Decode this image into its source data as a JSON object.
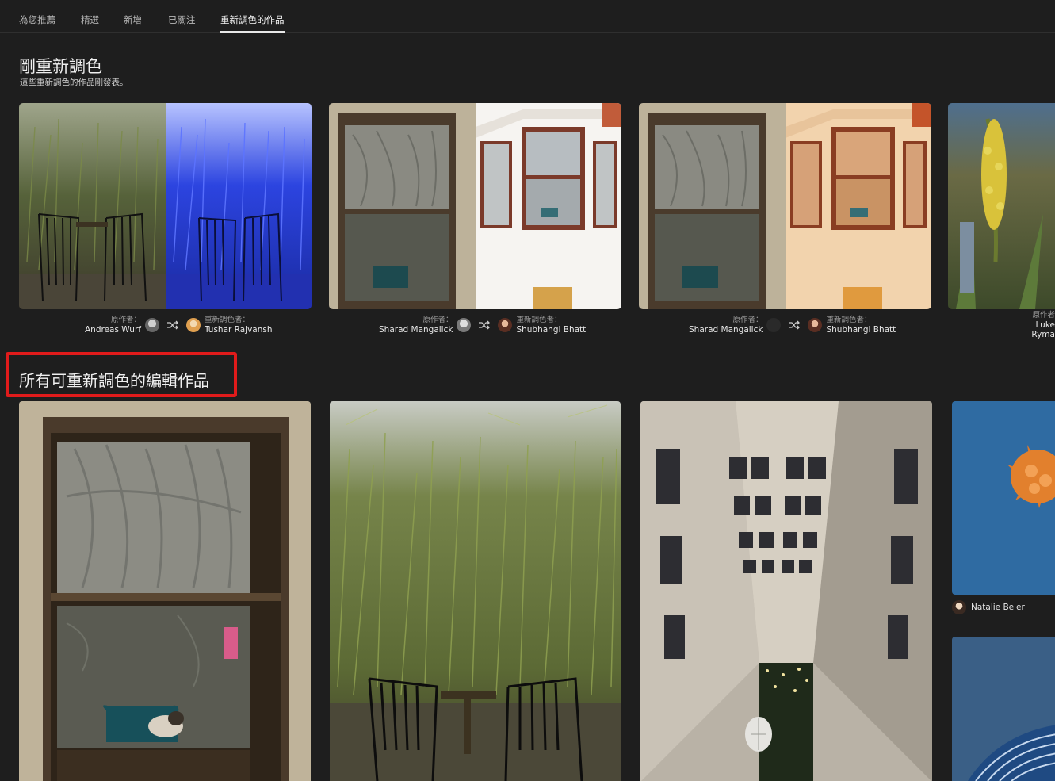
{
  "tabs": [
    {
      "label": "為您推薦",
      "active": false
    },
    {
      "label": "精選",
      "active": false
    },
    {
      "label": "新增",
      "active": false
    },
    {
      "label": "已關注",
      "active": false
    },
    {
      "label": "重新調色的作品",
      "active": true
    }
  ],
  "section1": {
    "title": "剛重新調色",
    "subtitle": "這些重新調色的作品剛發表。",
    "cards": [
      {
        "original_label": "原作者：",
        "original_name": "Andreas Wurf",
        "remix_label": "重新調色者：",
        "remix_name": "Tushar Rajvansh"
      },
      {
        "original_label": "原作者：",
        "original_name": "Sharad Mangalick",
        "remix_label": "重新調色者：",
        "remix_name": "Shubhangi Bhatt"
      },
      {
        "original_label": "原作者：",
        "original_name": "Sharad Mangalick",
        "remix_label": "重新調色者：",
        "remix_name": "Shubhangi Bhatt"
      },
      {
        "original_label": "原作者",
        "original_name": "Luke Ryma"
      }
    ]
  },
  "section2": {
    "title": "所有可重新調色的編輯作品",
    "author_name": "Natalie Be'er"
  },
  "icons": {
    "swap": "shuffle-icon"
  },
  "colors": {
    "background": "#1e1e1e",
    "highlight": "#e01b1b"
  }
}
